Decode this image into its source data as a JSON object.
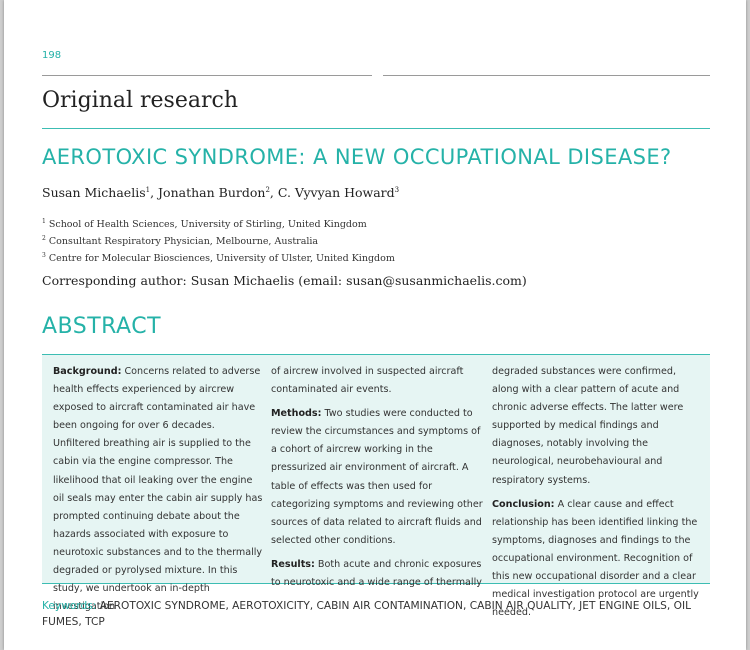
{
  "header": {
    "page_number": "198",
    "section": "Original research"
  },
  "article": {
    "title": "AEROTOXIC SYNDROME: A NEW OCCUPATIONAL DISEASE?",
    "authors": [
      {
        "name": "Susan Michaelis",
        "aff": "1"
      },
      {
        "name": "Jonathan Burdon",
        "aff": "2"
      },
      {
        "name": "C. Vyvyan Howard",
        "aff": "3"
      }
    ],
    "affiliations": [
      {
        "num": "1",
        "text": "School of Health Sciences, University of Stirling, United Kingdom"
      },
      {
        "num": "2",
        "text": "Consultant Respiratory Physician, Melbourne, Australia"
      },
      {
        "num": "3",
        "text": "Centre for Molecular Biosciences, University of Ulster, United Kingdom"
      }
    ],
    "corresponding": "Corresponding author: Susan Michaelis (email: susan@susanmichaelis.com)"
  },
  "abstract": {
    "heading": "ABSTRACT",
    "col1": {
      "background_label": "Background:",
      "background_text": " Concerns related to adverse health effects experienced by aircrew exposed to aircraft contaminated air have been ongoing for over 6 decades. Unfiltered breathing air is supplied to the cabin via the engine compressor. The likelihood that oil leaking over the engine oil seals may enter the cabin air supply has prompted continuing debate about the hazards associated with exposure to neurotoxic substances and to the thermally degraded or pyrolysed mixture. In this study, we undertook an in-depth investigation"
    },
    "col2": {
      "cont_text": "of aircrew involved in suspected aircraft contaminated air events.",
      "methods_label": "Methods:",
      "methods_text": " Two studies were conducted to review the circumstances and symptoms of a cohort of aircrew working in the pressurized air environment of aircraft. A table of effects was then used for categorizing symptoms and reviewing other sources of data related to aircraft fluids and selected other conditions.",
      "results_label": "Results:",
      "results_text": " Both acute and chronic exposures to neurotoxic and a wide range of thermally"
    },
    "col3": {
      "cont_text": "degraded substances were confirmed, along with a clear pattern of acute and chronic adverse effects. The latter were supported by medical findings and diagnoses, notably involving the neurological, neurobehavioural and respiratory systems.",
      "conclusion_label": "Conclusion:",
      "conclusion_text": " A clear cause and effect relationship has been identified linking the symptoms, diagnoses and findings to the occupational environment. Recognition of this new occupational disorder and a clear medical investigation protocol are urgently needed."
    }
  },
  "keywords": {
    "label": "Keywords:",
    "text": " AEROTOXIC SYNDROME, AEROTOXICITY, CABIN AIR CONTAMINATION, CABIN AIR QUALITY, JET ENGINE OILS, OIL FUMES, TCP"
  },
  "colors": {
    "accent": "#25b2a8",
    "abstract_bg": "#e6f5f3"
  }
}
